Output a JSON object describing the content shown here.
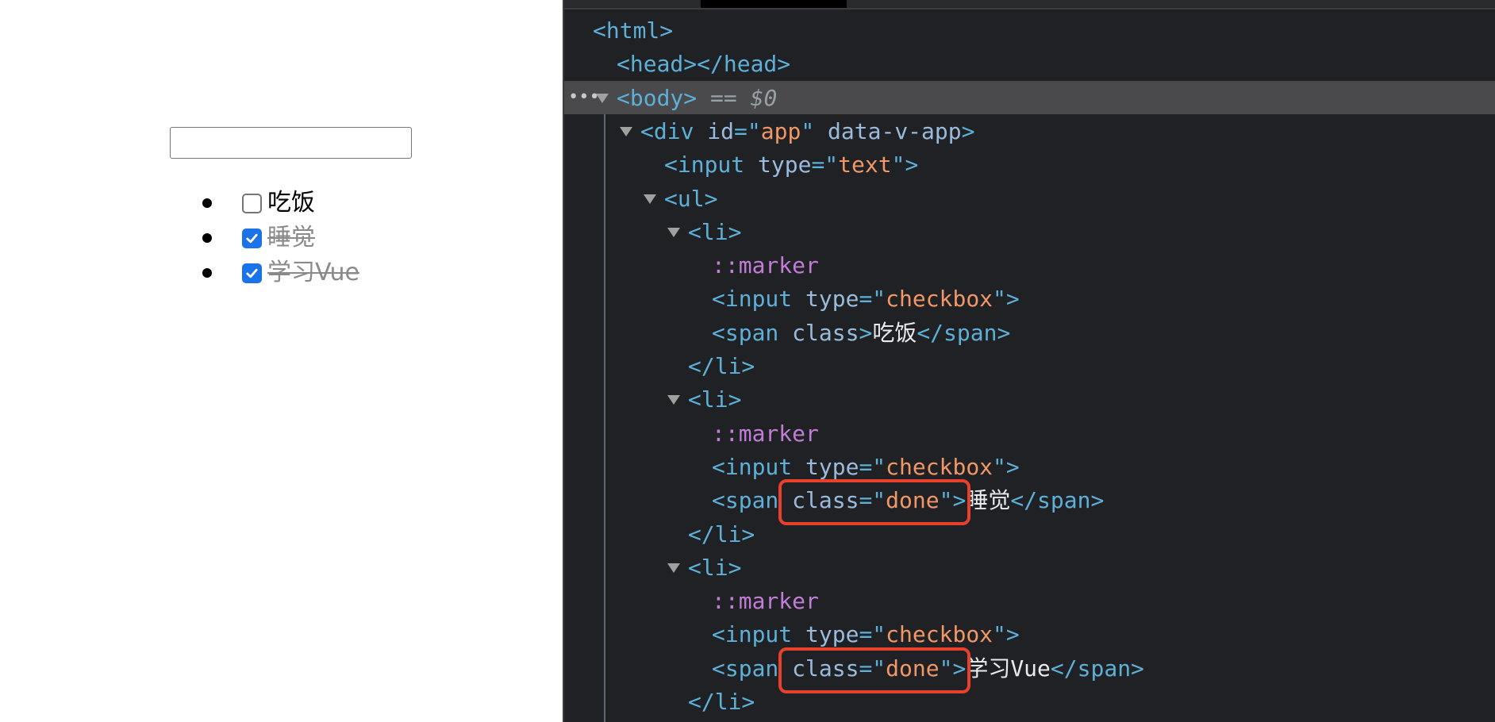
{
  "todo": {
    "input_value": "",
    "items": [
      {
        "label": "吃饭",
        "checked": false,
        "done": false
      },
      {
        "label": "睡觉",
        "checked": true,
        "done": true
      },
      {
        "label": "学习Vue",
        "checked": true,
        "done": true
      }
    ]
  },
  "devtools": {
    "lines": [
      {
        "indent": 0,
        "expand": false,
        "parts": [
          [
            "tag",
            "<html>"
          ]
        ]
      },
      {
        "indent": 1,
        "expand": false,
        "parts": [
          [
            "tag",
            "<head></head>"
          ]
        ]
      },
      {
        "indent": 1,
        "expand": true,
        "selected": true,
        "parts": [
          [
            "tag",
            "<body>"
          ],
          [
            "muted",
            " == "
          ],
          [
            "muted",
            "$0"
          ]
        ]
      },
      {
        "indent": 2,
        "expand": true,
        "parts": [
          [
            "tag",
            "<div "
          ],
          [
            "attr",
            "id"
          ],
          [
            "tag",
            "=\""
          ],
          [
            "val",
            "app"
          ],
          [
            "tag",
            "\" "
          ],
          [
            "attr",
            "data-v-app"
          ],
          [
            "tag",
            ">"
          ]
        ]
      },
      {
        "indent": 3,
        "expand": false,
        "parts": [
          [
            "tag",
            "<input "
          ],
          [
            "attr",
            "type"
          ],
          [
            "tag",
            "=\""
          ],
          [
            "val",
            "text"
          ],
          [
            "tag",
            "\">"
          ]
        ]
      },
      {
        "indent": 3,
        "expand": true,
        "parts": [
          [
            "tag",
            "<ul>"
          ]
        ]
      },
      {
        "indent": 4,
        "expand": true,
        "parts": [
          [
            "tag",
            "<li>"
          ]
        ]
      },
      {
        "indent": 5,
        "expand": false,
        "parts": [
          [
            "pseudo",
            "::marker"
          ]
        ]
      },
      {
        "indent": 5,
        "expand": false,
        "parts": [
          [
            "tag",
            "<input "
          ],
          [
            "attr",
            "type"
          ],
          [
            "tag",
            "=\""
          ],
          [
            "val",
            "checkbox"
          ],
          [
            "tag",
            "\">"
          ]
        ]
      },
      {
        "indent": 5,
        "expand": false,
        "parts": [
          [
            "tag",
            "<span "
          ],
          [
            "attr",
            "class"
          ],
          [
            "tag",
            ">"
          ],
          [
            "txt",
            "吃饭"
          ],
          [
            "tag",
            "</span>"
          ]
        ]
      },
      {
        "indent": 4,
        "expand": false,
        "parts": [
          [
            "tag",
            "</li>"
          ]
        ]
      },
      {
        "indent": 4,
        "expand": true,
        "parts": [
          [
            "tag",
            "<li>"
          ]
        ]
      },
      {
        "indent": 5,
        "expand": false,
        "parts": [
          [
            "pseudo",
            "::marker"
          ]
        ]
      },
      {
        "indent": 5,
        "expand": false,
        "parts": [
          [
            "tag",
            "<input "
          ],
          [
            "attr",
            "type"
          ],
          [
            "tag",
            "=\""
          ],
          [
            "val",
            "checkbox"
          ],
          [
            "tag",
            "\">"
          ]
        ]
      },
      {
        "indent": 5,
        "expand": false,
        "parts": [
          [
            "tag",
            "<span "
          ],
          [
            "attr",
            "class"
          ],
          [
            "tag",
            "=\""
          ],
          [
            "val",
            "done"
          ],
          [
            "tag",
            "\">"
          ],
          [
            "txt",
            "睡觉"
          ],
          [
            "tag",
            "</span>"
          ]
        ]
      },
      {
        "indent": 4,
        "expand": false,
        "parts": [
          [
            "tag",
            "</li>"
          ]
        ]
      },
      {
        "indent": 4,
        "expand": true,
        "parts": [
          [
            "tag",
            "<li>"
          ]
        ]
      },
      {
        "indent": 5,
        "expand": false,
        "parts": [
          [
            "pseudo",
            "::marker"
          ]
        ]
      },
      {
        "indent": 5,
        "expand": false,
        "parts": [
          [
            "tag",
            "<input "
          ],
          [
            "attr",
            "type"
          ],
          [
            "tag",
            "=\""
          ],
          [
            "val",
            "checkbox"
          ],
          [
            "tag",
            "\">"
          ]
        ]
      },
      {
        "indent": 5,
        "expand": false,
        "parts": [
          [
            "tag",
            "<span "
          ],
          [
            "attr",
            "class"
          ],
          [
            "tag",
            "=\""
          ],
          [
            "val",
            "done"
          ],
          [
            "tag",
            "\">"
          ],
          [
            "txt",
            "学习Vue"
          ],
          [
            "tag",
            "</span>"
          ]
        ]
      },
      {
        "indent": 4,
        "expand": false,
        "parts": [
          [
            "tag",
            "</li>"
          ]
        ]
      }
    ],
    "highlighted_lines": [
      14,
      19
    ]
  },
  "colors": {
    "tag": "#5db0d7",
    "attr": "#9bbbdc",
    "value": "#f29766",
    "pseudo": "#c27dd6",
    "highlight_box": "#e8402a",
    "checkbox_checked": "#1a73e8"
  }
}
